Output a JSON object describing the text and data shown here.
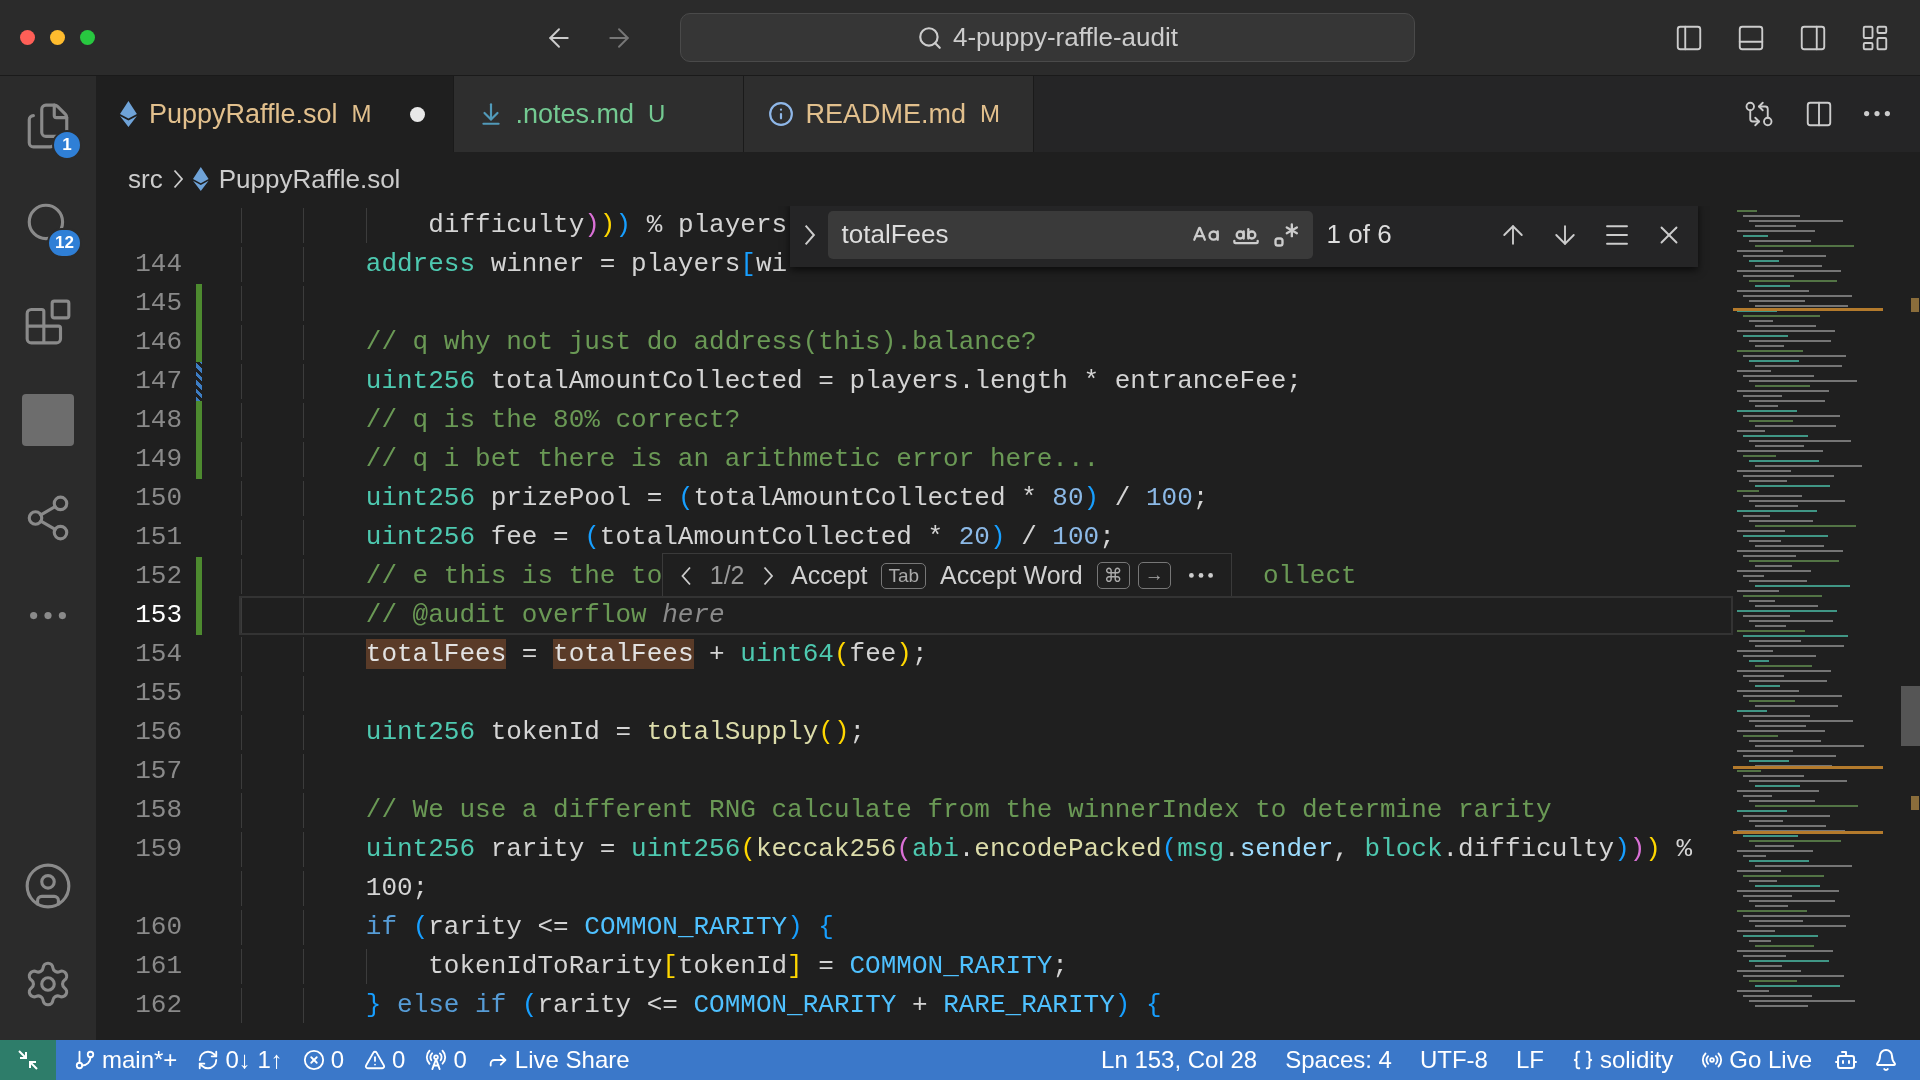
{
  "title_bar": {
    "command_center": "4-puppy-raffle-audit"
  },
  "activity_bar": {
    "items": [
      {
        "kind": "files",
        "badge": "1"
      },
      {
        "kind": "search",
        "badge": "12"
      },
      {
        "kind": "extensions"
      },
      {
        "kind": "picture"
      },
      {
        "kind": "live-share"
      },
      {
        "kind": "more"
      }
    ],
    "bottom_items": [
      {
        "kind": "account"
      },
      {
        "kind": "settings"
      }
    ]
  },
  "tabs": [
    {
      "label": "PuppyRaffle.sol",
      "kind": "solidity",
      "git_status": "M",
      "color": "#e2c08d",
      "dirty": true,
      "selected": true
    },
    {
      "label": ".notes.md",
      "kind": "markdown",
      "git_status": "U",
      "color": "#73c991",
      "dirty": false,
      "selected": false
    },
    {
      "label": "README.md",
      "kind": "info",
      "git_status": "M",
      "color": "#e2c08d",
      "dirty": false,
      "selected": false
    }
  ],
  "breadcrumb": [
    "src",
    "PuppyRaffle.sol"
  ],
  "find_widget": {
    "query": "totalFees",
    "options": [
      {
        "kind": "match-case",
        "on": false
      },
      {
        "kind": "whole-word",
        "on": false
      },
      {
        "kind": "regex",
        "on": false
      }
    ],
    "result": "1 of 6"
  },
  "suggestion_toolbar": {
    "counter": "1/2",
    "accept": "Accept",
    "accept_key": "Tab",
    "accept_word": "Accept Word",
    "accept_word_keys": [
      "⌘",
      "→"
    ]
  },
  "lines": [
    {
      "nested": true,
      "current": false,
      "added": false,
      "modified": false,
      "tokens": [
        {
          "kind": "plain",
          "text": "difficulty"
        },
        {
          "kind": "b2",
          "text": ")"
        },
        {
          "kind": "b1",
          "text": ")"
        },
        {
          "kind": "b3",
          "text": ")"
        },
        {
          "kind": "plain",
          "text": " % players"
        }
      ]
    },
    {
      "number": "144",
      "nested": false,
      "current": false,
      "added": false,
      "modified": false,
      "tokens": [
        {
          "kind": "type",
          "text": "address"
        },
        {
          "kind": "plain",
          "text": " winner = players"
        },
        {
          "kind": "b3",
          "text": "["
        },
        {
          "kind": "plain",
          "text": "wi"
        }
      ]
    },
    {
      "number": "145",
      "nested": false,
      "current": false,
      "added": true,
      "modified": false
    },
    {
      "number": "146",
      "nested": false,
      "current": false,
      "added": true,
      "modified": false,
      "tokens": [
        {
          "kind": "comment",
          "text": "// q why not just do address(this).balance?"
        }
      ]
    },
    {
      "number": "147",
      "nested": false,
      "current": false,
      "added": false,
      "modified": true,
      "tokens": [
        {
          "kind": "type",
          "text": "uint256"
        },
        {
          "kind": "plain",
          "text": " totalAmountCollected = players.length * entranceFee;"
        }
      ]
    },
    {
      "number": "148",
      "nested": false,
      "current": false,
      "added": true,
      "modified": false,
      "tokens": [
        {
          "kind": "comment",
          "text": "// q is the 80% correct?"
        }
      ]
    },
    {
      "number": "149",
      "nested": false,
      "current": false,
      "added": true,
      "modified": false,
      "tokens": [
        {
          "kind": "comment",
          "text": "// q i bet there is an arithmetic error here..."
        }
      ]
    },
    {
      "number": "150",
      "nested": false,
      "current": false,
      "added": false,
      "modified": false,
      "tokens": [
        {
          "kind": "type",
          "text": "uint256"
        },
        {
          "kind": "plain",
          "text": " prizePool = "
        },
        {
          "kind": "b3",
          "text": "("
        },
        {
          "kind": "plain",
          "text": "totalAmountCollected * "
        },
        {
          "kind": "num",
          "text": "80"
        },
        {
          "kind": "b3",
          "text": ")"
        },
        {
          "kind": "plain",
          "text": " / "
        },
        {
          "kind": "num",
          "text": "100"
        },
        {
          "kind": "plain",
          "text": ";"
        }
      ]
    },
    {
      "number": "151",
      "nested": false,
      "current": false,
      "added": false,
      "modified": false,
      "tokens": [
        {
          "kind": "type",
          "text": "uint256"
        },
        {
          "kind": "plain",
          "text": " fee = "
        },
        {
          "kind": "b3",
          "text": "("
        },
        {
          "kind": "plain",
          "text": "totalAmountCollected * "
        },
        {
          "kind": "num",
          "text": "20"
        },
        {
          "kind": "b3",
          "text": ")"
        },
        {
          "kind": "plain",
          "text": " / "
        },
        {
          "kind": "num",
          "text": "100"
        },
        {
          "kind": "plain",
          "text": ";"
        }
      ]
    },
    {
      "number": "152",
      "nested": false,
      "current": false,
      "added": true,
      "modified": false,
      "tokens": [
        {
          "kind": "comment",
          "text": "// e this is the to"
        },
        {
          "kind": "suggestion-toolbar"
        },
        {
          "kind": "comment",
          "text": "ollect"
        }
      ]
    },
    {
      "number": "153",
      "nested": false,
      "current": true,
      "added": true,
      "modified": false,
      "tokens": [
        {
          "kind": "comment",
          "text": "// @audit overflow "
        },
        {
          "kind": "ghost",
          "text": "here"
        }
      ]
    },
    {
      "number": "154",
      "nested": false,
      "current": false,
      "added": false,
      "modified": false,
      "tokens": [
        {
          "kind": "match",
          "text": "totalFees"
        },
        {
          "kind": "plain",
          "text": " = "
        },
        {
          "kind": "match",
          "text": "totalFees"
        },
        {
          "kind": "plain",
          "text": " + "
        },
        {
          "kind": "type",
          "text": "uint64"
        },
        {
          "kind": "b1",
          "text": "("
        },
        {
          "kind": "plain",
          "text": "fee"
        },
        {
          "kind": "b1",
          "text": ")"
        },
        {
          "kind": "plain",
          "text": ";"
        }
      ]
    },
    {
      "number": "155",
      "nested": false,
      "current": false,
      "added": false,
      "modified": false
    },
    {
      "number": "156",
      "nested": false,
      "current": false,
      "added": false,
      "modified": false,
      "tokens": [
        {
          "kind": "type",
          "text": "uint256"
        },
        {
          "kind": "plain",
          "text": " tokenId = "
        },
        {
          "kind": "func",
          "text": "totalSupply"
        },
        {
          "kind": "b1",
          "text": "()"
        },
        {
          "kind": "plain",
          "text": ";"
        }
      ]
    },
    {
      "number": "157",
      "nested": false,
      "current": false,
      "added": false,
      "modified": false
    },
    {
      "number": "158",
      "nested": false,
      "current": false,
      "added": false,
      "modified": false,
      "tokens": [
        {
          "kind": "comment",
          "text": "// We use a different RNG calculate from the winnerIndex to determine rarity"
        }
      ]
    },
    {
      "number": "159",
      "nested": false,
      "current": false,
      "added": false,
      "modified": false,
      "tokens": [
        {
          "kind": "type",
          "text": "uint256"
        },
        {
          "kind": "plain",
          "text": " rarity = "
        },
        {
          "kind": "type",
          "text": "uint256"
        },
        {
          "kind": "b1",
          "text": "("
        },
        {
          "kind": "func",
          "text": "keccak256"
        },
        {
          "kind": "b2",
          "text": "("
        },
        {
          "kind": "type",
          "text": "abi"
        },
        {
          "kind": "plain",
          "text": "."
        },
        {
          "kind": "func",
          "text": "encodePacked"
        },
        {
          "kind": "b3",
          "text": "("
        },
        {
          "kind": "type",
          "text": "msg"
        },
        {
          "kind": "plain",
          "text": "."
        },
        {
          "kind": "var",
          "text": "sender"
        },
        {
          "kind": "plain",
          "text": ", "
        },
        {
          "kind": "type",
          "text": "block"
        },
        {
          "kind": "plain",
          "text": ".difficulty"
        },
        {
          "kind": "b3",
          "text": ")"
        },
        {
          "kind": "b2",
          "text": ")"
        },
        {
          "kind": "b1",
          "text": ")"
        },
        {
          "kind": "plain",
          "text": " %"
        }
      ]
    },
    {
      "nested": false,
      "current": false,
      "added": false,
      "modified": false,
      "tokens": [
        {
          "kind": "plain",
          "text": "100;"
        }
      ]
    },
    {
      "number": "160",
      "nested": false,
      "current": false,
      "added": false,
      "modified": false,
      "tokens": [
        {
          "kind": "kw",
          "text": "if"
        },
        {
          "kind": "b3",
          "text": " ("
        },
        {
          "kind": "plain",
          "text": "rarity <= "
        },
        {
          "kind": "const",
          "text": "COMMON_RARITY"
        },
        {
          "kind": "b3",
          "text": ")"
        },
        {
          "kind": "b3",
          "text": " {"
        }
      ]
    },
    {
      "number": "161",
      "nested": true,
      "current": false,
      "added": false,
      "modified": false,
      "tokens": [
        {
          "kind": "plain",
          "text": "tokenIdToRarity"
        },
        {
          "kind": "b1",
          "text": "["
        },
        {
          "kind": "plain",
          "text": "tokenId"
        },
        {
          "kind": "b1",
          "text": "]"
        },
        {
          "kind": "plain",
          "text": " = "
        },
        {
          "kind": "const",
          "text": "COMMON_RARITY"
        },
        {
          "kind": "plain",
          "text": ";"
        }
      ]
    },
    {
      "number": "162",
      "nested": false,
      "current": false,
      "added": false,
      "modified": false,
      "tokens": [
        {
          "kind": "b3",
          "text": "}"
        },
        {
          "kind": "kw",
          "text": " else"
        },
        {
          "kind": "kw",
          "text": " if"
        },
        {
          "kind": "b3",
          "text": " ("
        },
        {
          "kind": "plain",
          "text": "rarity <= "
        },
        {
          "kind": "const",
          "text": "COMMON_RARITY"
        },
        {
          "kind": "plain",
          "text": " + "
        },
        {
          "kind": "const",
          "text": "RARE_RARITY"
        },
        {
          "kind": "b3",
          "text": ")"
        },
        {
          "kind": "b3",
          "text": " {"
        }
      ]
    }
  ],
  "status_bar": {
    "left": [
      {
        "kind": "branch",
        "text": "main*+"
      },
      {
        "kind": "sync",
        "text": "0↓ 1↑"
      },
      {
        "kind": "errors",
        "text": "0"
      },
      {
        "kind": "warnings",
        "text": "0"
      },
      {
        "kind": "ports",
        "text": "0"
      },
      {
        "kind": "live-share",
        "text": "Live Share"
      }
    ],
    "right": [
      {
        "kind": "text",
        "text": "Ln 153, Col 28"
      },
      {
        "kind": "text",
        "text": "Spaces: 4"
      },
      {
        "kind": "text",
        "text": "UTF-8"
      },
      {
        "kind": "text",
        "text": "LF"
      },
      {
        "kind": "language",
        "text": "solidity"
      },
      {
        "kind": "go-live",
        "text": "Go Live"
      },
      {
        "kind": "copilot"
      },
      {
        "kind": "bell"
      }
    ]
  }
}
